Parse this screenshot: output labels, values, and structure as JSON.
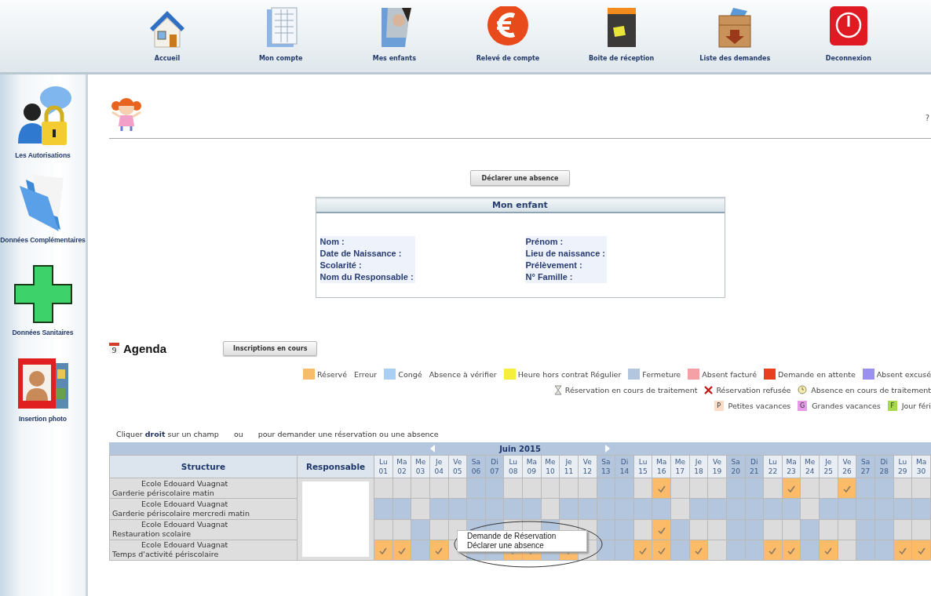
{
  "nav": [
    {
      "label": "Accueil",
      "kind": "house"
    },
    {
      "label": "Mon compte",
      "kind": "sheet"
    },
    {
      "label": "Mes enfants",
      "kind": "photo"
    },
    {
      "label": "Relevé de compte",
      "kind": "euro"
    },
    {
      "label": "Boite de réception",
      "kind": "inbox"
    },
    {
      "label": "Liste des demandes",
      "kind": "crate"
    },
    {
      "label": "Deconnexion",
      "kind": "power"
    }
  ],
  "sidebar": {
    "items": [
      {
        "label": "Les Autorisations",
        "kind": "userlock"
      },
      {
        "label": "Données Complémentaires",
        "kind": "folder"
      },
      {
        "label": "Données Sanitaires",
        "kind": "cross"
      },
      {
        "label": "Insertion photo",
        "kind": "frame"
      }
    ]
  },
  "help": "?",
  "declare_button": "Déclarer une absence",
  "child_panel": {
    "title": "Mon enfant",
    "fields_left": [
      "Nom :",
      "Date de Naissance :",
      "Scolarité :",
      "Nom du Responsable :"
    ],
    "fields_right": [
      "Prénom :",
      "Lieu de naissance :",
      "Prélèvement :",
      "N° Famille :"
    ]
  },
  "agenda": {
    "calendar_day": "9",
    "title": "Agenda",
    "button": "Inscriptions en cours",
    "legend": [
      [
        {
          "label": "Réservé",
          "color": "#f9bb6c"
        },
        {
          "label": "Erreur"
        },
        {
          "label": "Congé",
          "color": "#a9cff2"
        },
        {
          "label": "Absence à vérifier"
        },
        {
          "label": "Heure hors contrat Régulier",
          "color": "#f6ee3c"
        },
        {
          "label": "Fermeture",
          "color": "#b3c6de"
        },
        {
          "label": "Absent facturé",
          "color": "#f4a0a4"
        },
        {
          "label": "Demande en attente",
          "color": "#e8401e"
        },
        {
          "label": "Absent excusé",
          "color": "#9a90f0"
        }
      ],
      [
        {
          "label": "Réservation en cours de traitement",
          "kind": "hourglass"
        },
        {
          "label": "Réservation refusée",
          "kind": "cross"
        },
        {
          "label": "Absence en cours de traitement",
          "kind": "magnifier"
        }
      ],
      [
        {
          "label": "Petites vacances",
          "kind": "badge",
          "letter": "P",
          "color": "#fbdcc8"
        },
        {
          "label": "Grandes vacances",
          "kind": "badge",
          "letter": "G",
          "color": "#e89ae8"
        },
        {
          "label": "Jour féri",
          "kind": "badge",
          "letter": "F",
          "color": "#a6d84a"
        }
      ]
    ],
    "instruction": [
      "Cliquer **droit** sur un champ",
      "ou",
      "pour demander une réservation ou une absence"
    ],
    "month": "Juin 2015",
    "columns": [
      "Structure",
      "Responsable"
    ],
    "days": [
      {
        "weekday": "Lu",
        "date": "01",
        "weekend": false
      },
      {
        "weekday": "Ma",
        "date": "02",
        "weekend": false
      },
      {
        "weekday": "Me",
        "date": "03",
        "weekend": false
      },
      {
        "weekday": "Je",
        "date": "04",
        "weekend": false
      },
      {
        "weekday": "Ve",
        "date": "05",
        "weekend": false
      },
      {
        "weekday": "Sa",
        "date": "06",
        "weekend": true
      },
      {
        "weekday": "Di",
        "date": "07",
        "weekend": true
      },
      {
        "weekday": "Lu",
        "date": "08",
        "weekend": false
      },
      {
        "weekday": "Ma",
        "date": "09",
        "weekend": false
      },
      {
        "weekday": "Me",
        "date": "10",
        "weekend": false
      },
      {
        "weekday": "Je",
        "date": "11",
        "weekend": false
      },
      {
        "weekday": "Ve",
        "date": "12",
        "weekend": false
      },
      {
        "weekday": "Sa",
        "date": "13",
        "weekend": true
      },
      {
        "weekday": "Di",
        "date": "14",
        "weekend": true
      },
      {
        "weekday": "Lu",
        "date": "15",
        "weekend": false
      },
      {
        "weekday": "Ma",
        "date": "16",
        "weekend": false
      },
      {
        "weekday": "Me",
        "date": "17",
        "weekend": false
      },
      {
        "weekday": "Je",
        "date": "18",
        "weekend": false
      },
      {
        "weekday": "Ve",
        "date": "19",
        "weekend": false
      },
      {
        "weekday": "Sa",
        "date": "20",
        "weekend": true
      },
      {
        "weekday": "Di",
        "date": "21",
        "weekend": true
      },
      {
        "weekday": "Lu",
        "date": "22",
        "weekend": false
      },
      {
        "weekday": "Ma",
        "date": "23",
        "weekend": false
      },
      {
        "weekday": "Me",
        "date": "24",
        "weekend": false
      },
      {
        "weekday": "Je",
        "date": "25",
        "weekend": false
      },
      {
        "weekday": "Ve",
        "date": "26",
        "weekend": false
      },
      {
        "weekday": "Sa",
        "date": "27",
        "weekend": true
      },
      {
        "weekday": "Di",
        "date": "28",
        "weekend": true
      },
      {
        "weekday": "Lu",
        "date": "29",
        "weekend": false
      },
      {
        "weekday": "Ma",
        "date": "30",
        "weekend": false
      }
    ],
    "rows": [
      {
        "school": "Ecole Edouard Vuagnat",
        "service": "Garderie périscolaire matin",
        "days": [
          {
            "closed": false,
            "reserved": false
          },
          {
            "closed": false,
            "reserved": false
          },
          {
            "closed": false,
            "reserved": false
          },
          {
            "closed": false,
            "reserved": false
          },
          {
            "closed": false,
            "reserved": false
          },
          {
            "closed": true,
            "reserved": false
          },
          {
            "closed": true,
            "reserved": false
          },
          {
            "closed": false,
            "reserved": false
          },
          {
            "closed": false,
            "reserved": false
          },
          {
            "closed": false,
            "reserved": false
          },
          {
            "closed": false,
            "reserved": false
          },
          {
            "closed": false,
            "reserved": false
          },
          {
            "closed": true,
            "reserved": false
          },
          {
            "closed": true,
            "reserved": false
          },
          {
            "closed": false,
            "reserved": false
          },
          {
            "closed": false,
            "reserved": true
          },
          {
            "closed": false,
            "reserved": false
          },
          {
            "closed": false,
            "reserved": false
          },
          {
            "closed": false,
            "reserved": false
          },
          {
            "closed": true,
            "reserved": false
          },
          {
            "closed": true,
            "reserved": false
          },
          {
            "closed": false,
            "reserved": false
          },
          {
            "closed": false,
            "reserved": true
          },
          {
            "closed": false,
            "reserved": false
          },
          {
            "closed": false,
            "reserved": false
          },
          {
            "closed": false,
            "reserved": true
          },
          {
            "closed": true,
            "reserved": false
          },
          {
            "closed": true,
            "reserved": false
          },
          {
            "closed": false,
            "reserved": false
          },
          {
            "closed": false,
            "reserved": false
          }
        ]
      },
      {
        "school": "Ecole Edouard Vuagnat",
        "service": "Garderie périscolaire mercredi matin",
        "days": [
          {
            "closed": true,
            "reserved": false
          },
          {
            "closed": true,
            "reserved": false
          },
          {
            "closed": false,
            "reserved": false
          },
          {
            "closed": true,
            "reserved": false
          },
          {
            "closed": true,
            "reserved": false
          },
          {
            "closed": true,
            "reserved": false
          },
          {
            "closed": true,
            "reserved": false
          },
          {
            "closed": true,
            "reserved": false
          },
          {
            "closed": true,
            "reserved": false
          },
          {
            "closed": false,
            "reserved": false
          },
          {
            "closed": true,
            "reserved": false
          },
          {
            "closed": true,
            "reserved": false
          },
          {
            "closed": true,
            "reserved": false
          },
          {
            "closed": true,
            "reserved": false
          },
          {
            "closed": true,
            "reserved": false
          },
          {
            "closed": true,
            "reserved": false
          },
          {
            "closed": false,
            "reserved": false
          },
          {
            "closed": true,
            "reserved": false
          },
          {
            "closed": true,
            "reserved": false
          },
          {
            "closed": true,
            "reserved": false
          },
          {
            "closed": true,
            "reserved": false
          },
          {
            "closed": true,
            "reserved": false
          },
          {
            "closed": true,
            "reserved": false
          },
          {
            "closed": false,
            "reserved": false
          },
          {
            "closed": true,
            "reserved": false
          },
          {
            "closed": true,
            "reserved": false
          },
          {
            "closed": true,
            "reserved": false
          },
          {
            "closed": true,
            "reserved": false
          },
          {
            "closed": true,
            "reserved": false
          },
          {
            "closed": true,
            "reserved": false
          }
        ]
      },
      {
        "school": "Ecole Edouard Vuagnat",
        "service": "Restauration scolaire",
        "days": [
          {
            "closed": false,
            "reserved": false
          },
          {
            "closed": false,
            "reserved": false
          },
          {
            "closed": true,
            "reserved": false
          },
          {
            "closed": false,
            "reserved": false
          },
          {
            "closed": false,
            "reserved": false
          },
          {
            "closed": true,
            "reserved": false
          },
          {
            "closed": true,
            "reserved": false
          },
          {
            "closed": false,
            "reserved": false
          },
          {
            "closed": false,
            "reserved": false
          },
          {
            "closed": true,
            "reserved": false
          },
          {
            "closed": false,
            "reserved": false
          },
          {
            "closed": false,
            "reserved": false
          },
          {
            "closed": true,
            "reserved": false
          },
          {
            "closed": true,
            "reserved": false
          },
          {
            "closed": false,
            "reserved": false
          },
          {
            "closed": false,
            "reserved": true
          },
          {
            "closed": true,
            "reserved": false
          },
          {
            "closed": false,
            "reserved": false
          },
          {
            "closed": false,
            "reserved": false
          },
          {
            "closed": true,
            "reserved": false
          },
          {
            "closed": true,
            "reserved": false
          },
          {
            "closed": false,
            "reserved": false
          },
          {
            "closed": false,
            "reserved": false
          },
          {
            "closed": true,
            "reserved": false
          },
          {
            "closed": false,
            "reserved": false
          },
          {
            "closed": false,
            "reserved": false
          },
          {
            "closed": true,
            "reserved": false
          },
          {
            "closed": true,
            "reserved": false
          },
          {
            "closed": false,
            "reserved": false
          },
          {
            "closed": false,
            "reserved": false
          }
        ]
      },
      {
        "school": "Ecole Edouard Vuagnat",
        "service": "Temps d'activité périscolaire",
        "days": [
          {
            "closed": false,
            "reserved": true
          },
          {
            "closed": false,
            "reserved": true
          },
          {
            "closed": true,
            "reserved": false
          },
          {
            "closed": false,
            "reserved": true
          },
          {
            "closed": false,
            "reserved": false
          },
          {
            "closed": true,
            "reserved": false
          },
          {
            "closed": true,
            "reserved": false
          },
          {
            "closed": false,
            "reserved": true
          },
          {
            "closed": false,
            "reserved": true
          },
          {
            "closed": true,
            "reserved": false
          },
          {
            "closed": false,
            "reserved": true
          },
          {
            "closed": false,
            "reserved": false
          },
          {
            "closed": true,
            "reserved": false
          },
          {
            "closed": true,
            "reserved": false
          },
          {
            "closed": false,
            "reserved": true
          },
          {
            "closed": false,
            "reserved": true
          },
          {
            "closed": true,
            "reserved": false
          },
          {
            "closed": false,
            "reserved": true
          },
          {
            "closed": false,
            "reserved": false
          },
          {
            "closed": true,
            "reserved": false
          },
          {
            "closed": true,
            "reserved": false
          },
          {
            "closed": false,
            "reserved": true
          },
          {
            "closed": false,
            "reserved": true
          },
          {
            "closed": true,
            "reserved": false
          },
          {
            "closed": false,
            "reserved": true
          },
          {
            "closed": false,
            "reserved": false
          },
          {
            "closed": true,
            "reserved": false
          },
          {
            "closed": true,
            "reserved": false
          },
          {
            "closed": false,
            "reserved": true
          },
          {
            "closed": false,
            "reserved": true
          }
        ]
      }
    ]
  },
  "context_menu": {
    "items": [
      "Demande de Réservation",
      "Déclarer une absence"
    ]
  }
}
